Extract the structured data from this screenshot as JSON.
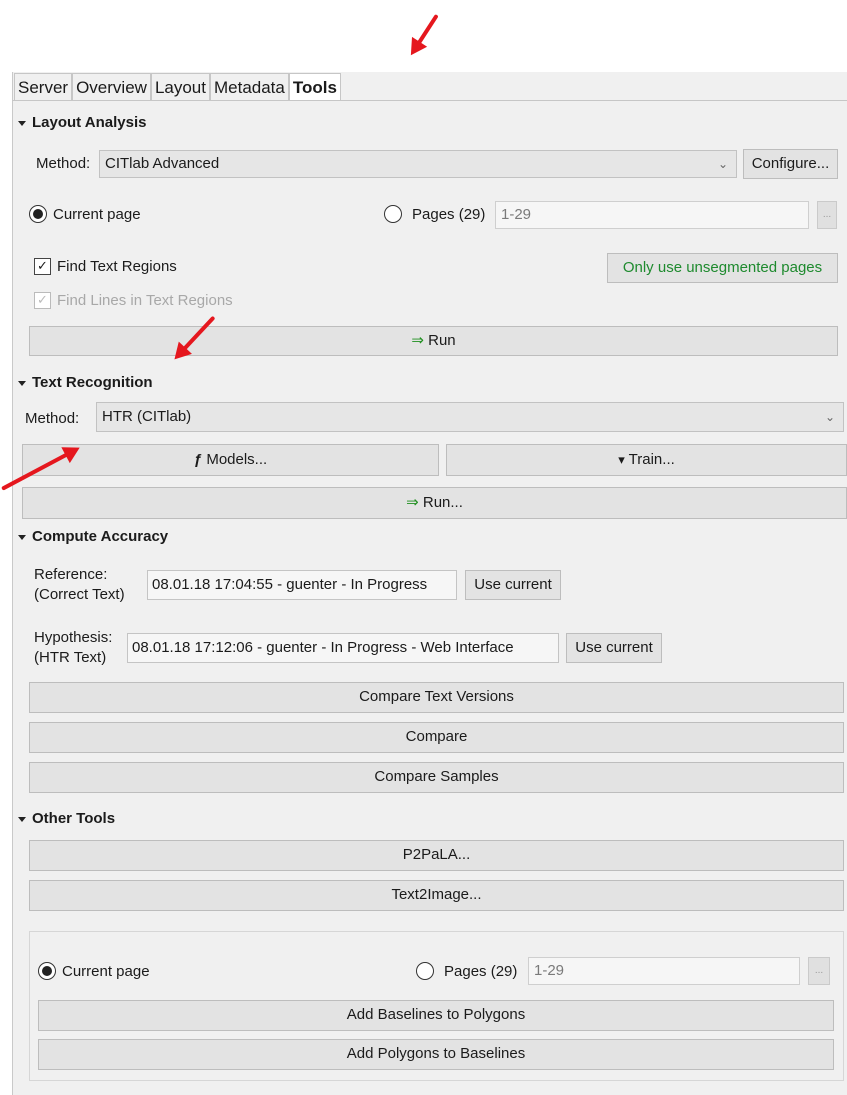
{
  "tabs": [
    "Server",
    "Overview",
    "Layout",
    "Metadata",
    "Tools"
  ],
  "layout_analysis": {
    "title": "Layout Analysis",
    "method_label": "Method:",
    "method_value": "CITlab Advanced",
    "configure": "Configure...",
    "current_page": "Current page",
    "pages_label": "Pages (29)",
    "pages_value": "1-29",
    "dots": "...",
    "find_regions": "Find Text Regions",
    "find_lines": "Find Lines in Text Regions",
    "only_unsegmented": "Only use unsegmented pages",
    "run": "Run"
  },
  "text_recognition": {
    "title": "Text Recognition",
    "method_label": "Method:",
    "method_value": "HTR (CITlab)",
    "models": "Models...",
    "train": "Train...",
    "run": "Run..."
  },
  "compute_accuracy": {
    "title": "Compute Accuracy",
    "reference_label_1": "Reference:",
    "reference_label_2": "(Correct Text)",
    "reference_value": "08.01.18 17:04:55 - guenter - In Progress",
    "hypothesis_label_1": "Hypothesis:",
    "hypothesis_label_2": "(HTR Text)",
    "hypothesis_value": "08.01.18 17:12:06 - guenter - In Progress - Web Interface",
    "use_current": "Use current",
    "compare_versions": "Compare Text Versions",
    "compare": "Compare",
    "compare_samples": "Compare Samples"
  },
  "other_tools": {
    "title": "Other Tools",
    "p2pala": "P2PaLA...",
    "text2image": "Text2Image...",
    "current_page": "Current page",
    "pages_label": "Pages (29)",
    "pages_value": "1-29",
    "dots": "...",
    "add_baselines": "Add Baselines to Polygons",
    "add_polygons": "Add Polygons to Baselines"
  },
  "colors": {
    "annotation_arrow": "#e5171e",
    "run_arrow": "#1e8f1e",
    "panel_bg": "#f0f0f0"
  }
}
